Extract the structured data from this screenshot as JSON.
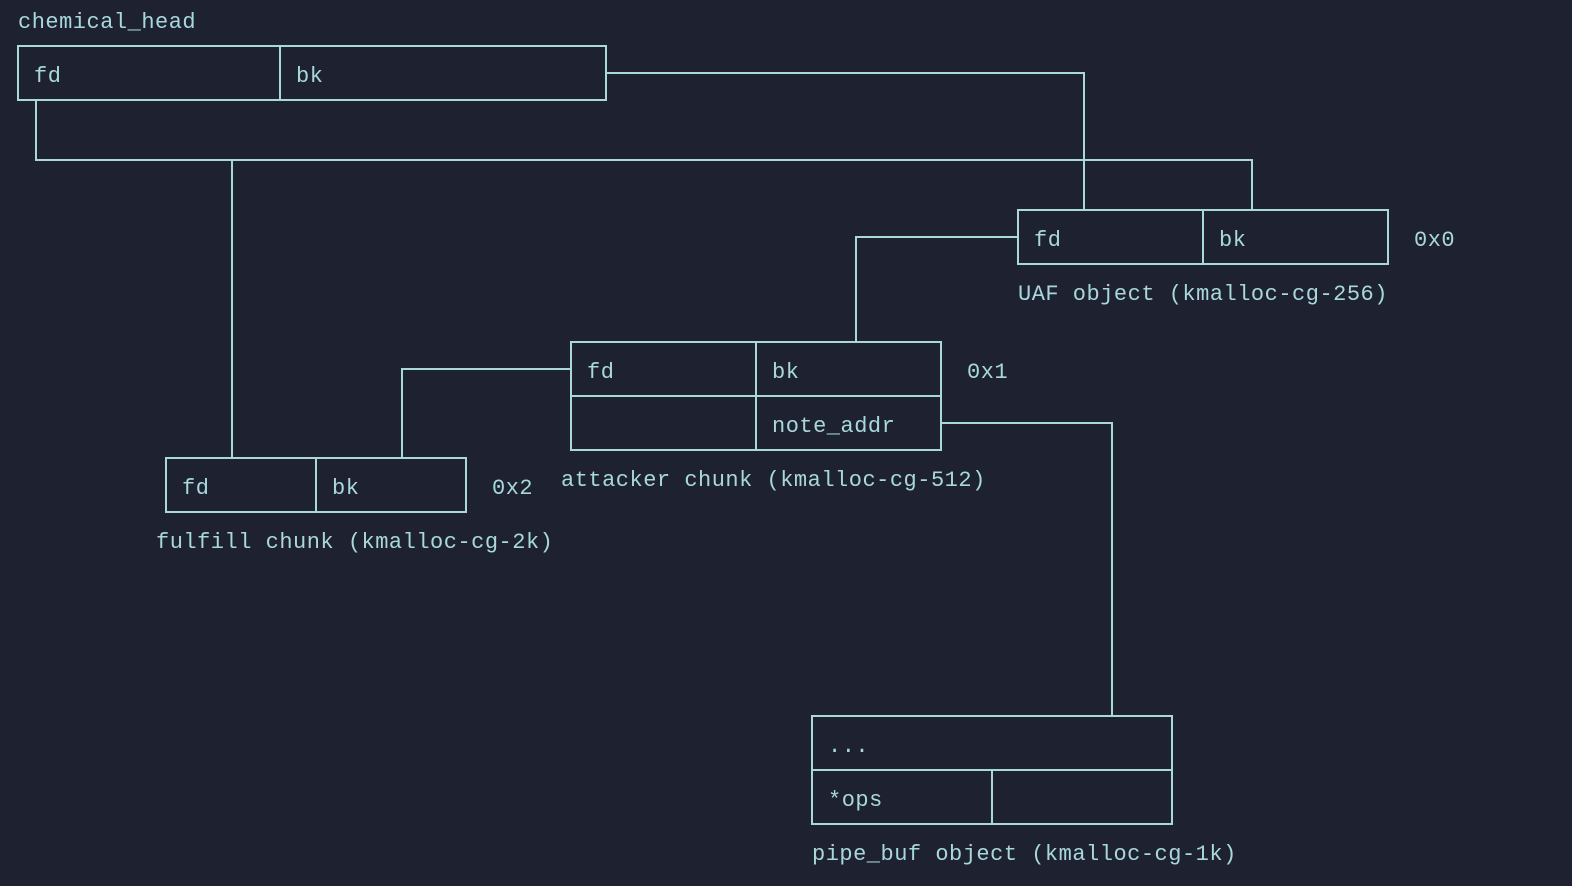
{
  "nodes": {
    "head": {
      "title": "chemical_head",
      "fd": "fd",
      "bk": "bk"
    },
    "uaf": {
      "fd": "fd",
      "bk": "bk",
      "side": "0x0",
      "caption": "UAF object (kmalloc-cg-256)"
    },
    "attacker": {
      "fd": "fd",
      "bk": "bk",
      "note": "note_addr",
      "side": "0x1",
      "caption": "attacker chunk (kmalloc-cg-512)"
    },
    "fulfill": {
      "fd": "fd",
      "bk": "bk",
      "side": "0x2",
      "caption": "fulfill chunk (kmalloc-cg-2k)"
    },
    "pipebuf": {
      "dots": "...",
      "ops": "*ops",
      "caption": "pipe_buf object (kmalloc-cg-1k)"
    }
  }
}
